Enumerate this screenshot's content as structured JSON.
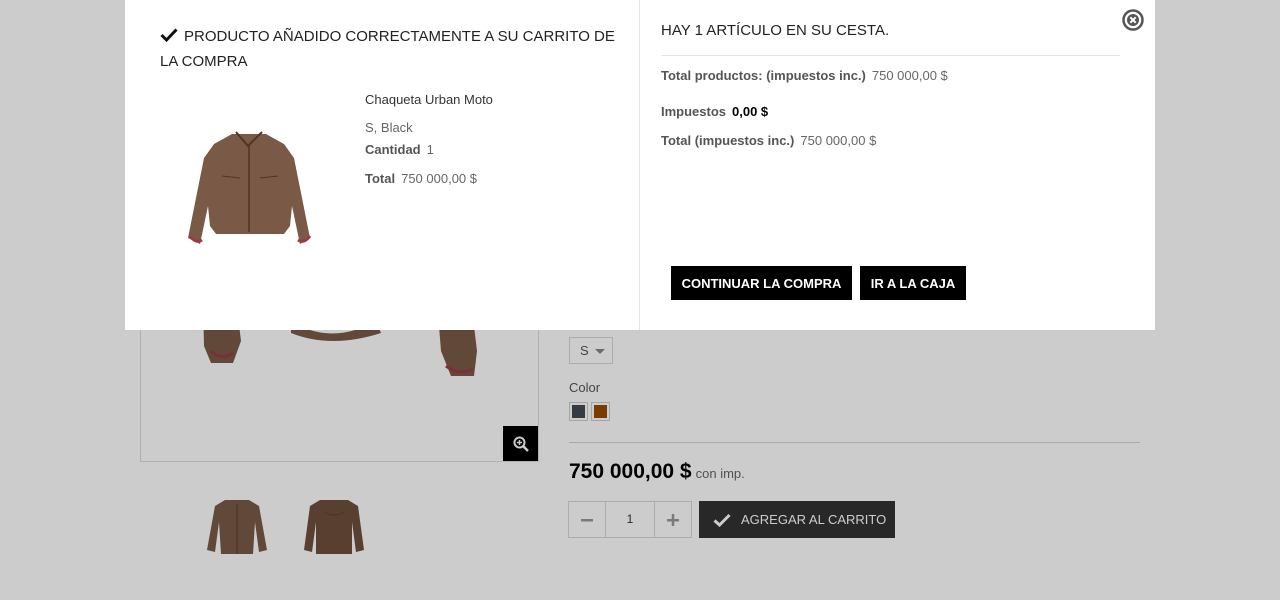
{
  "product_page": {
    "size_value": "S",
    "color_label": "Color",
    "swatches": [
      {
        "name": "Black",
        "color": "#434a54"
      },
      {
        "name": "Brown",
        "color": "#964b00"
      }
    ],
    "price": "750 000,00 $",
    "price_suffix": "con imp.",
    "quantity": "1",
    "add_to_cart_label": "AGREGAR AL CARRITO"
  },
  "modal": {
    "success_title": "PRODUCTO AÑADIDO CORRECTAMENTE A SU CARRITO DE LA COMPRA",
    "product_name": "Chaqueta Urban Moto",
    "product_attributes": "S, Black",
    "quantity_label": "Cantidad",
    "quantity_value": "1",
    "total_label": "Total",
    "total_value": "750 000,00 $",
    "cart_count_text": "HAY 1 ARTÍCULO EN SU CESTA.",
    "total_products_label": "Total productos: (impuestos inc.)",
    "total_products_value": "750 000,00 $",
    "taxes_label": "Impuestos",
    "taxes_value": "0,00 $",
    "grand_total_label": "Total (impuestos inc.)",
    "grand_total_value": "750 000,00 $",
    "continue_label": "CONTINUAR LA COMPRA",
    "checkout_label": "IR A LA CAJA"
  },
  "colors": {
    "overlay": "rgba(0,0,0,0.2)",
    "button_dark": "#000000",
    "add_cart_bg": "#333333",
    "jacket": "#7a5a46"
  },
  "icons": [
    "check-icon",
    "close-circle-icon",
    "zoom-icon",
    "minus-icon",
    "plus-icon",
    "caret-down-icon"
  ]
}
